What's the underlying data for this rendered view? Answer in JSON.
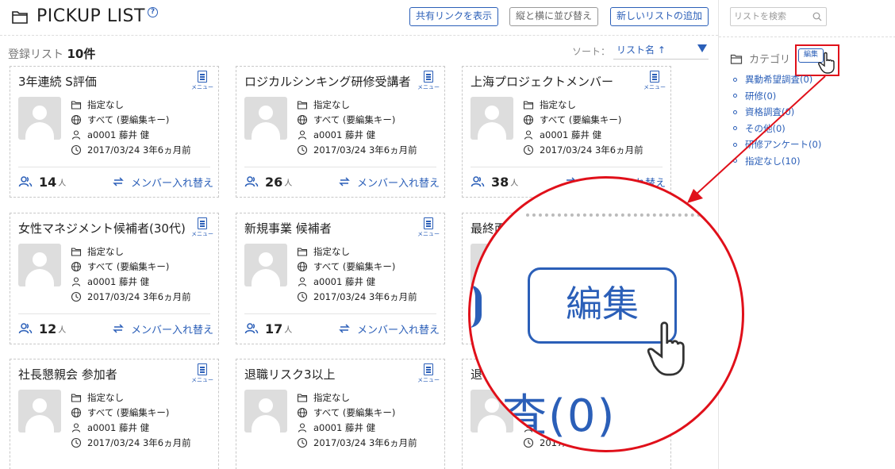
{
  "header": {
    "title": "PICKUP LIST",
    "help_label": "?",
    "buttons": {
      "share": "共有リンクを表示",
      "arrange": "縦と横に並び替え",
      "add_list": "新しいリストの追加"
    }
  },
  "list_count": {
    "label": "登録リスト",
    "value": "10件"
  },
  "sort": {
    "label": "ソート：",
    "value": "リスト名 ↑"
  },
  "card_common": {
    "menu_label": "メニュー",
    "swap_label": "メンバー入れ替え",
    "members_unit": "人"
  },
  "cards": [
    {
      "title": "3年連続 S評価",
      "folder": "指定なし",
      "access": "すべて (要編集キー)",
      "owner": "a0001 藤井 健",
      "date": "2017/03/24 3年6ヵ月前",
      "members": "14"
    },
    {
      "title": "ロジカルシンキング研修受講者",
      "folder": "指定なし",
      "access": "すべて (要編集キー)",
      "owner": "a0001 藤井 健",
      "date": "2017/03/24 3年6ヵ月前",
      "members": "26"
    },
    {
      "title": "上海プロジェクトメンバー",
      "folder": "指定なし",
      "access": "すべて (要編集キー)",
      "owner": "a0001 藤井 健",
      "date": "2017/03/24 3年6ヵ月前",
      "members": "38"
    },
    {
      "title": "女性マネジメント候補者(30代)",
      "folder": "指定なし",
      "access": "すべて (要編集キー)",
      "owner": "a0001 藤井 健",
      "date": "2017/03/24 3年6ヵ月前",
      "members": "12"
    },
    {
      "title": "新規事業 候補者",
      "folder": "指定なし",
      "access": "すべて (要編集キー)",
      "owner": "a0001 藤井 健",
      "date": "2017/03/24 3年6ヵ月前",
      "members": "17"
    },
    {
      "title": "最終面",
      "folder": "",
      "access": "",
      "owner": "",
      "date": "",
      "members": ""
    },
    {
      "title": "社長懇親会 参加者",
      "folder": "指定なし",
      "access": "すべて (要編集キー)",
      "owner": "a0001 藤井 健",
      "date": "2017/03/24 3年6ヵ月前",
      "members": ""
    },
    {
      "title": "退職リスク3以上",
      "folder": "指定なし",
      "access": "すべて (要編集キー)",
      "owner": "a0001 藤井 健",
      "date": "2017/03/24 3年6ヵ月前",
      "members": ""
    },
    {
      "title": "退",
      "folder": "",
      "access": "",
      "owner": "",
      "date": "2017/0",
      "members": ""
    }
  ],
  "sidebar": {
    "search_placeholder": "リストを検索",
    "category_title": "カテゴリ",
    "edit_label": "編集",
    "categories": [
      {
        "label": "異動希望調査(0)"
      },
      {
        "label": "研修(0)"
      },
      {
        "label": "資格調査(0)"
      },
      {
        "label": "その他(0)"
      },
      {
        "label": "研修アンケート(0)"
      },
      {
        "label": "指定なし(10)"
      }
    ]
  },
  "magnifier": {
    "edit_label": "編集",
    "text": "査(0)"
  },
  "colors": {
    "accent": "#2b5fb8",
    "highlight": "#e0101a"
  }
}
